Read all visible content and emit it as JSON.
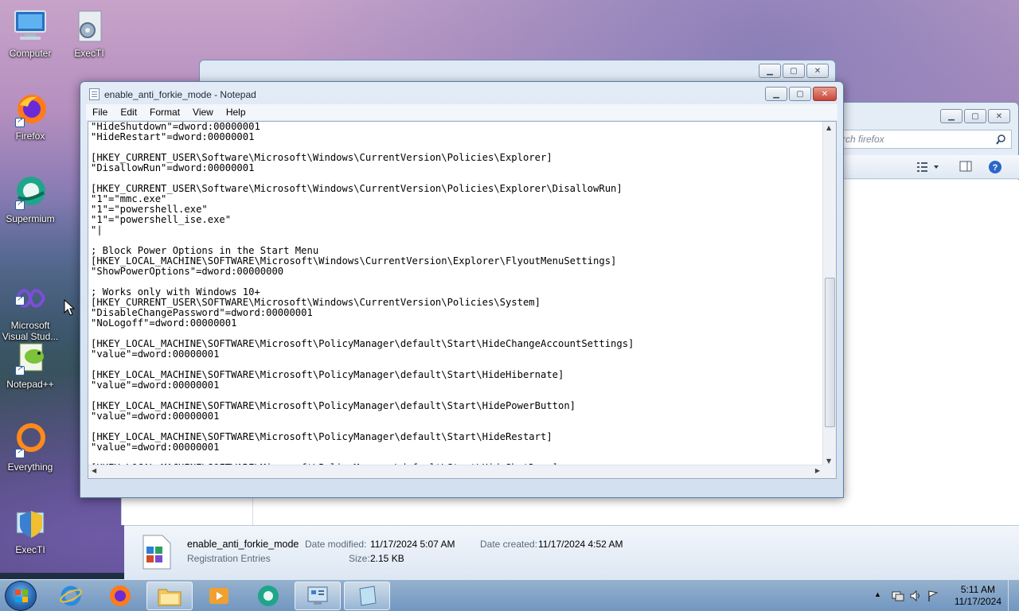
{
  "desktop": {
    "icons": [
      {
        "label": "Computer",
        "icon": "computer-icon"
      },
      {
        "label": "ExecTI",
        "icon": "execti-icon"
      },
      {
        "label": "Firefox",
        "icon": "firefox-icon"
      },
      {
        "label": "Supermium",
        "icon": "supermium-icon"
      },
      {
        "label": "Microsoft\nVisual Stud...",
        "icon": "visual-studio-icon"
      },
      {
        "label": "Notepad++",
        "icon": "notepadpp-icon"
      },
      {
        "label": "Everything",
        "icon": "everything-icon"
      },
      {
        "label": "ExecTI",
        "icon": "execti-shield-icon"
      }
    ]
  },
  "notepad": {
    "title": "enable_anti_forkie_mode - Notepad",
    "menu": [
      "File",
      "Edit",
      "Format",
      "View",
      "Help"
    ],
    "content": "\"HideShutdown\"=dword:00000001\n\"HideRestart\"=dword:00000001\n\n[HKEY_CURRENT_USER\\Software\\Microsoft\\Windows\\CurrentVersion\\Policies\\Explorer]\n\"DisallowRun\"=dword:00000001\n\n[HKEY_CURRENT_USER\\Software\\Microsoft\\Windows\\CurrentVersion\\Policies\\Explorer\\DisallowRun]\n\"1\"=\"mmc.exe\"\n\"1\"=\"powershell.exe\"\n\"1\"=\"powershell_ise.exe\"\n\"|\n\n; Block Power Options in the Start Menu\n[HKEY_LOCAL_MACHINE\\SOFTWARE\\Microsoft\\Windows\\CurrentVersion\\Explorer\\FlyoutMenuSettings]\n\"ShowPowerOptions\"=dword:00000000\n\n; Works only with Windows 10+\n[HKEY_CURRENT_USER\\SOFTWARE\\Microsoft\\Windows\\CurrentVersion\\Policies\\System]\n\"DisableChangePassword\"=dword:00000001\n\"NoLogoff\"=dword:00000001\n\n[HKEY_LOCAL_MACHINE\\SOFTWARE\\Microsoft\\PolicyManager\\default\\Start\\HideChangeAccountSettings]\n\"value\"=dword:00000001\n\n[HKEY_LOCAL_MACHINE\\SOFTWARE\\Microsoft\\PolicyManager\\default\\Start\\HideHibernate]\n\"value\"=dword:00000001\n\n[HKEY_LOCAL_MACHINE\\SOFTWARE\\Microsoft\\PolicyManager\\default\\Start\\HidePowerButton]\n\"value\"=dword:00000001\n\n[HKEY_LOCAL_MACHINE\\SOFTWARE\\Microsoft\\PolicyManager\\default\\Start\\HideRestart]\n\"value\"=dword:00000001\n\n[HKEY_LOCAL_MACHINE\\SOFTWARE\\Microsoft\\PolicyManager\\default\\Start\\HideShutDown]"
  },
  "explorer": {
    "search_placeholder": "rch firefox",
    "details": {
      "file_name": "enable_anti_forkie_mode",
      "file_type": "Registration Entries",
      "date_modified_label": "Date modified:",
      "date_modified": "11/17/2024 5:07 AM",
      "date_created_label": "Date created:",
      "date_created": "11/17/2024 4:52 AM",
      "size_label": "Size:",
      "size": "2.15 KB"
    }
  },
  "taskbar": {
    "clock_time": "5:11 AM",
    "clock_date": "11/17/2024"
  }
}
